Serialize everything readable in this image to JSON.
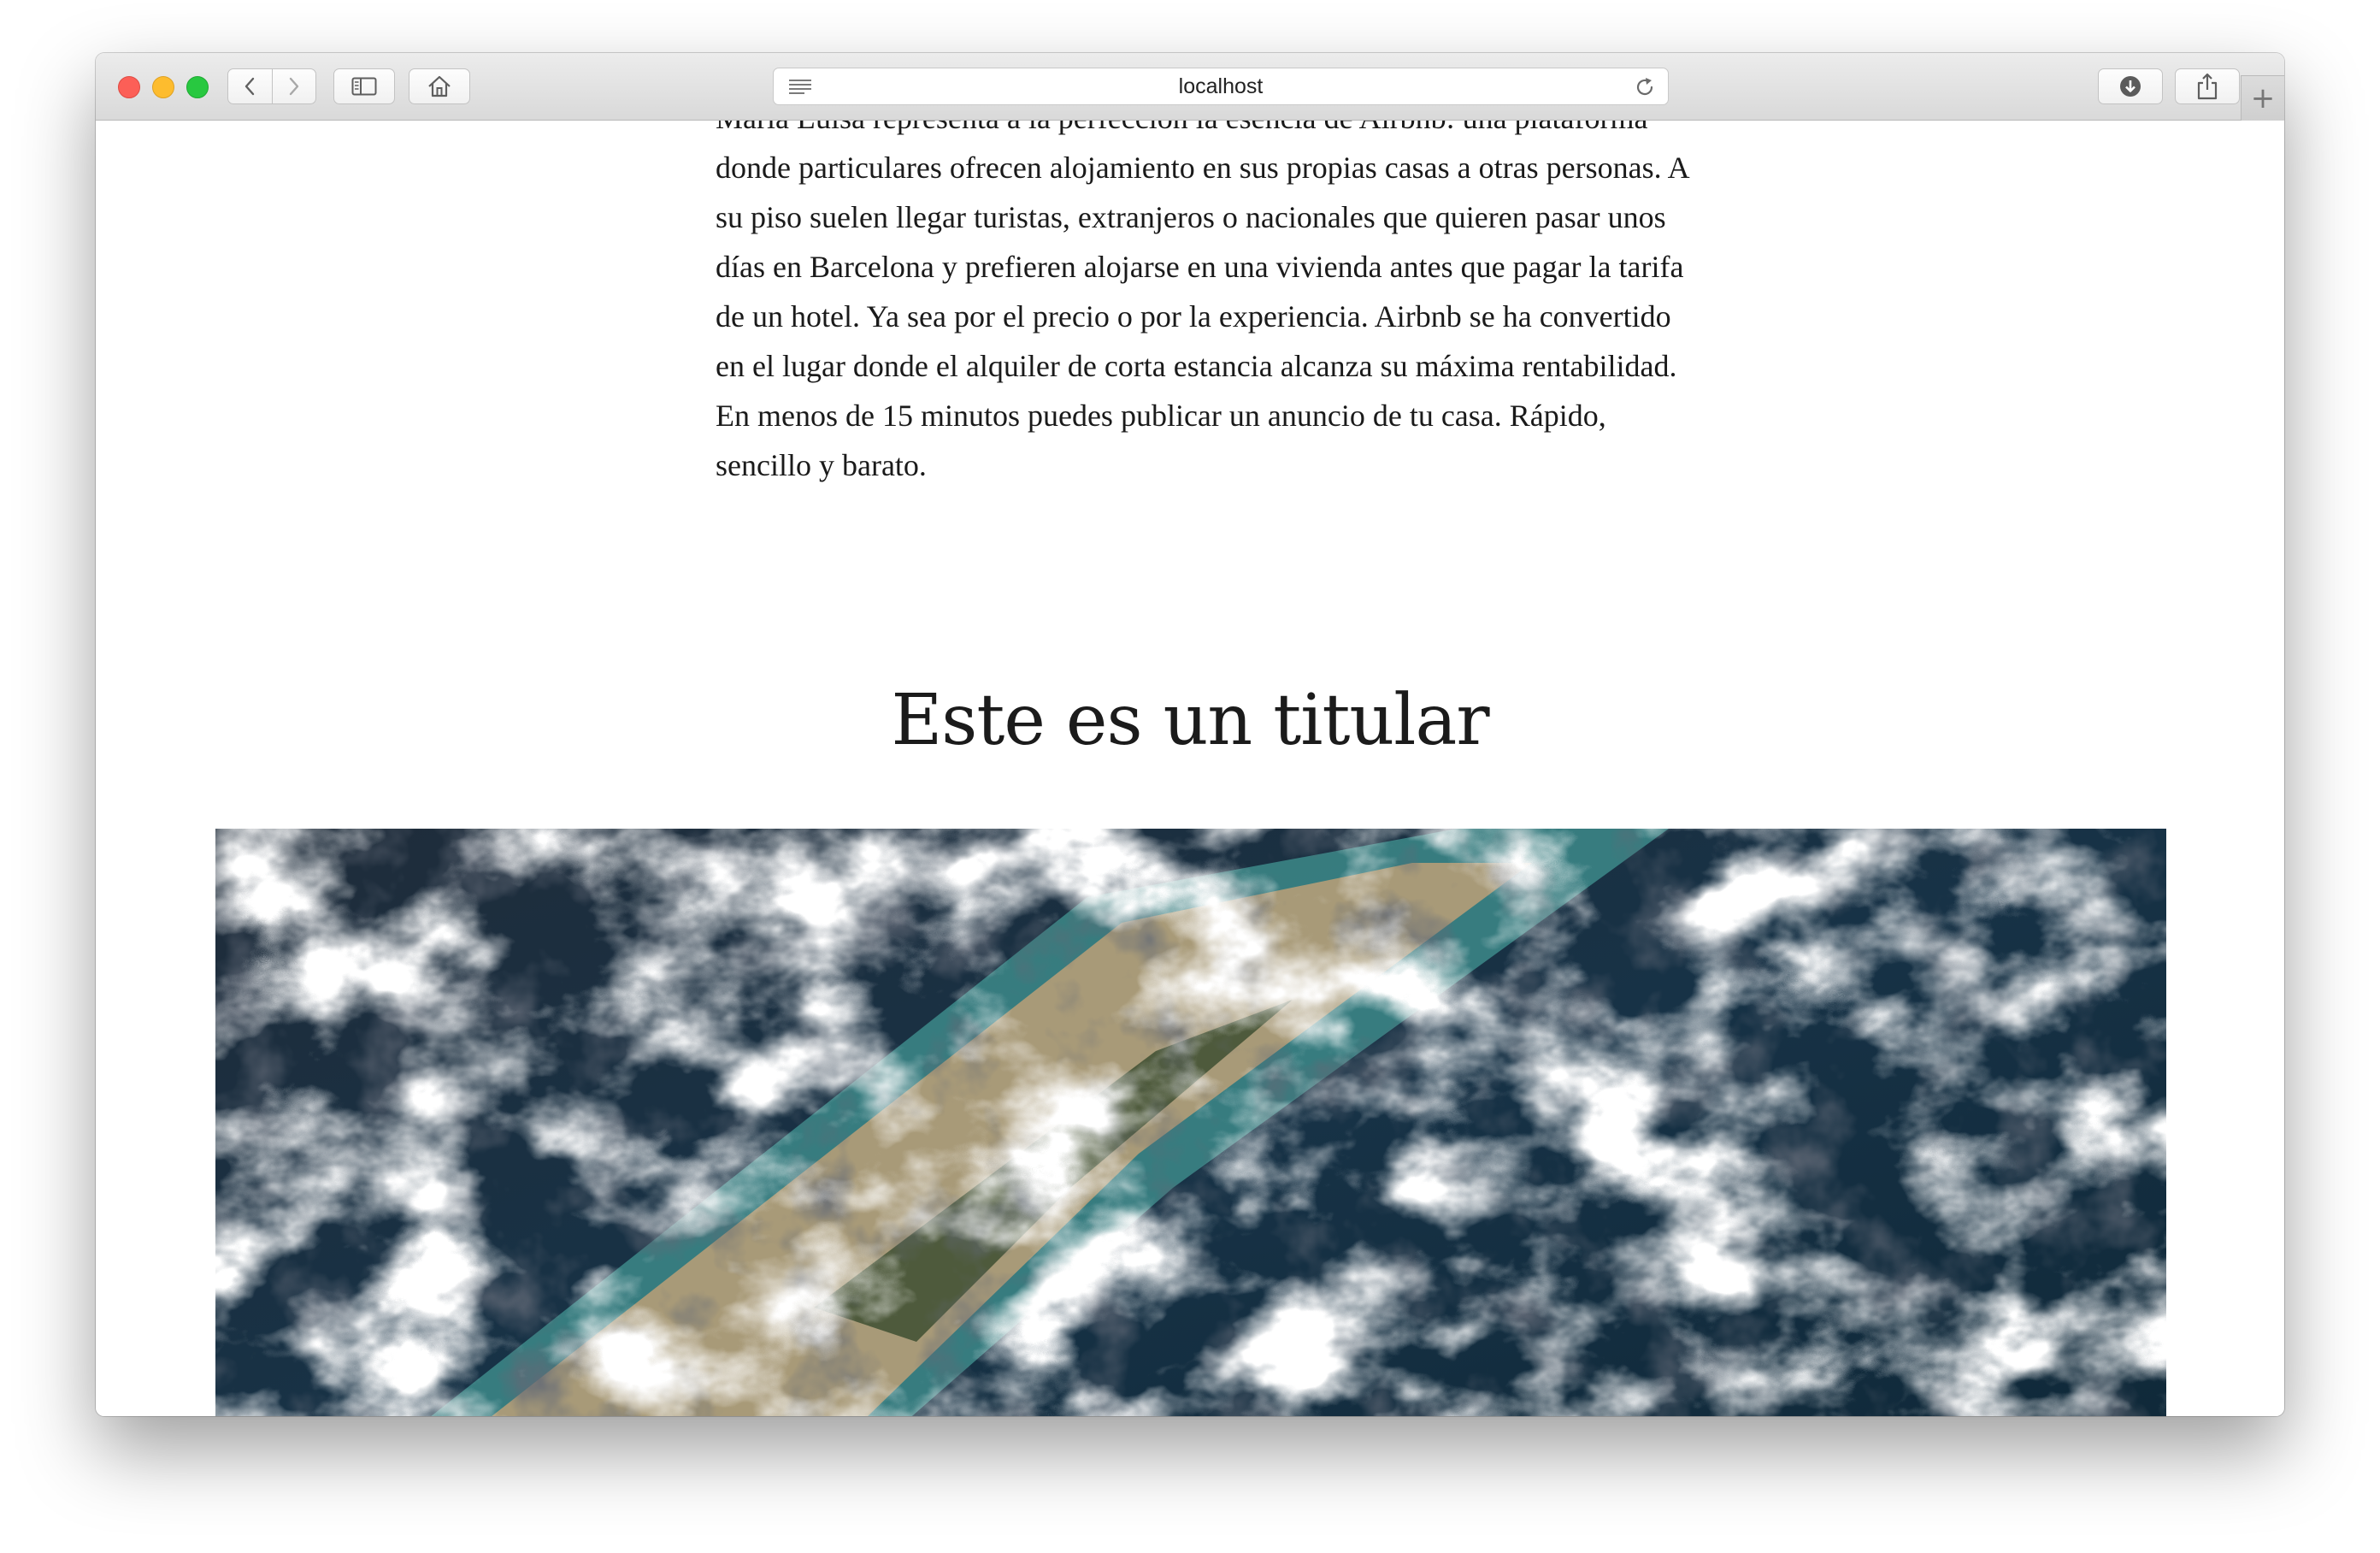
{
  "browser": {
    "address_url": "localhost",
    "buttons": {
      "back": "chevron-left-icon",
      "forward": "chevron-right-icon",
      "sidebar": "sidebar-icon",
      "home": "home-icon",
      "reader": "reader-lines-icon",
      "reload": "reload-icon",
      "downloads": "download-icon",
      "share": "share-icon",
      "new_tab": "+"
    },
    "colors": {
      "close": "#fc5f57",
      "minimize": "#fdbc2e",
      "maximize": "#28c840"
    }
  },
  "article": {
    "paragraph": "María Luisa representa a la perfección la esencia de Airbnb: una plataforma donde particulares ofrecen alojamiento en sus propias casas a otras personas. A su piso suelen llegar turistas, extranjeros o nacionales que quieren pasar unos días en Barcelona y prefieren alojarse en una vivienda antes que pagar la tarifa de un hotel. Ya sea por el precio o por la experiencia. Airbnb se ha convertido en el lugar donde el alquiler de corta estancia alcanza su máxima rentabilidad. En menos de 15 minutos puedes publicar un anuncio de tu casa. Rápido, sencillo y barato.",
    "headline": "Este es un titular",
    "image_subject": "satellite-view-clouds-over-coastline"
  }
}
